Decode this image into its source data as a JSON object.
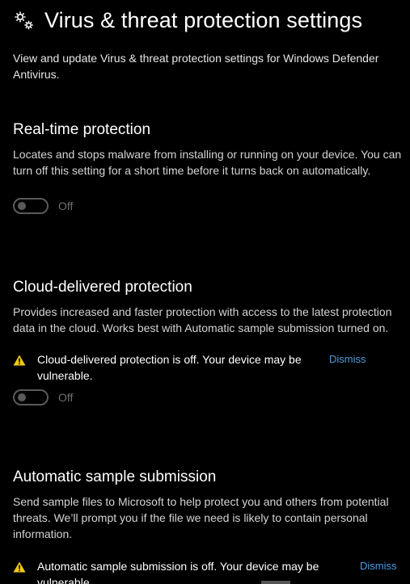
{
  "header": {
    "title": "Virus & threat protection settings",
    "description": "View and update Virus & threat protection settings for Windows Defender Antivirus."
  },
  "sections": [
    {
      "title": "Real-time protection",
      "description": "Locates and stops malware from installing or running on your device. You can turn off this setting for a short time before it turns back on automatically.",
      "toggle_state": "Off"
    },
    {
      "title": "Cloud-delivered protection",
      "description": "Provides increased and faster protection with access to the latest protection data in the cloud. Works best with Automatic sample submission turned on.",
      "warning": "Cloud-delivered protection is off. Your device may be vulnerable.",
      "dismiss_label": "Dismiss",
      "toggle_state": "Off"
    },
    {
      "title": "Automatic sample submission",
      "description": "Send sample files to Microsoft to help protect you and others from potential threats. We’ll prompt you if the file we need is likely to contain personal information.",
      "warning": "Automatic sample submission is off. Your device may be vulnerable.",
      "dismiss_label": "Dismiss"
    }
  ],
  "icons": {
    "header": "gears-icon",
    "warning": "warning-icon"
  },
  "colors": {
    "background": "#000000",
    "text": "#ffffff",
    "muted_text": "#d4d4d4",
    "toggle_off": "#5a5a5a",
    "link": "#4a9ce6",
    "warning": "#f2c811"
  }
}
